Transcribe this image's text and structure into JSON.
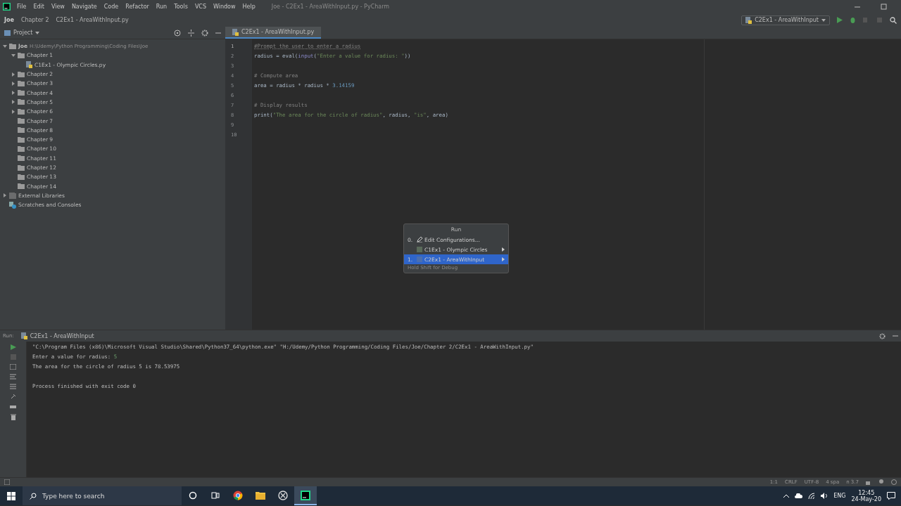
{
  "window": {
    "title": "Joe - C2Ex1 - AreaWithInput.py - PyCharm"
  },
  "menu": [
    "File",
    "Edit",
    "View",
    "Navigate",
    "Code",
    "Refactor",
    "Run",
    "Tools",
    "VCS",
    "Window",
    "Help"
  ],
  "breadcrumbs": [
    "Joe",
    "Chapter 2",
    "C2Ex1 - AreaWithInput.py"
  ],
  "run_config": "C2Ex1 - AreaWithInput",
  "project_panel": {
    "title": "Project"
  },
  "editor_tabs": [
    {
      "label": "C2Ex1 - AreaWithInput.py",
      "selected": true
    }
  ],
  "tree": [
    {
      "label": "Joe",
      "path": "H:\\Udemy\\Python Programming\\Coding Files\\Joe",
      "kind": "folder",
      "expanded": true,
      "children": [
        {
          "label": "Chapter 1",
          "kind": "folder",
          "expanded": true,
          "children": [
            {
              "label": "C1Ex1 - Olympic Circles.py",
              "kind": "file"
            }
          ]
        },
        {
          "label": "Chapter 2",
          "kind": "folder",
          "expanded": false
        },
        {
          "label": "Chapter 3",
          "kind": "folder",
          "expanded": false
        },
        {
          "label": "Chapter 4",
          "kind": "folder",
          "expanded": false
        },
        {
          "label": "Chapter 5",
          "kind": "folder",
          "expanded": false
        },
        {
          "label": "Chapter 6",
          "kind": "folder",
          "expanded": false
        },
        {
          "label": "Chapter 7",
          "kind": "folder"
        },
        {
          "label": "Chapter 8",
          "kind": "folder"
        },
        {
          "label": "Chapter 9",
          "kind": "folder"
        },
        {
          "label": "Chapter 10",
          "kind": "folder"
        },
        {
          "label": "Chapter 11",
          "kind": "folder"
        },
        {
          "label": "Chapter 12",
          "kind": "folder"
        },
        {
          "label": "Chapter 13",
          "kind": "folder"
        },
        {
          "label": "Chapter 14",
          "kind": "folder"
        }
      ]
    },
    {
      "label": "External Libraries",
      "kind": "library",
      "expanded": false
    },
    {
      "label": "Scratches and Consoles",
      "kind": "scratch"
    }
  ],
  "code": [
    {
      "number": "1",
      "tokens": [
        {
          "kind": "todo",
          "text": "#Prompt the user to enter a radius"
        }
      ]
    },
    {
      "number": "2",
      "tokens": [
        {
          "kind": "plain",
          "text": "radius = eval("
        },
        {
          "kind": "builtin",
          "text": "input"
        },
        {
          "kind": "plain",
          "text": "("
        },
        {
          "kind": "string",
          "text": "\"Enter a value for radius: \""
        },
        {
          "kind": "plain",
          "text": "))"
        }
      ]
    },
    {
      "number": "3"
    },
    {
      "number": "4",
      "tokens": [
        {
          "kind": "comment",
          "text": "# Compute area"
        }
      ]
    },
    {
      "number": "5",
      "tokens": [
        {
          "kind": "plain",
          "text": "area = radius * radius * "
        },
        {
          "kind": "number",
          "text": "3.14159"
        }
      ]
    },
    {
      "number": "6"
    },
    {
      "number": "7",
      "tokens": [
        {
          "kind": "comment",
          "text": "# Display results"
        }
      ]
    },
    {
      "number": "8",
      "tokens": [
        {
          "kind": "plain",
          "text": "print("
        },
        {
          "kind": "string",
          "text": "\"The area for the circle of radius\""
        },
        {
          "kind": "plain",
          "text": ", radius, "
        },
        {
          "kind": "string",
          "text": "\"is\""
        },
        {
          "kind": "plain",
          "text": ", area)"
        }
      ]
    },
    {
      "number": "9"
    },
    {
      "number": "10"
    }
  ],
  "run_popup": {
    "title": "Run",
    "hint": "Hold Shift for Debug",
    "items": [
      {
        "mnemonic": "0.",
        "label": "Edit Configurations...",
        "kind": "edit",
        "selected": false,
        "submenu": false
      },
      {
        "label": "C1Ex1 - Olympic Circles",
        "kind": "config",
        "selected": false,
        "submenu": true
      },
      {
        "mnemonic": "1.",
        "label": "C2Ex1 - AreaWithInput",
        "kind": "config",
        "selected": true,
        "submenu": true
      }
    ]
  },
  "run_panel": {
    "label": "Run:",
    "tab": "C2Ex1 - AreaWithInput",
    "lines": [
      {
        "kind": "command",
        "text": "\"C:\\Program Files (x86)\\Microsoft Visual Studio\\Shared\\Python37_64\\python.exe\" \"H:/Udemy/Python Programming/Coding Files/Joe/Chapter 2/C2Ex1 - AreaWithInput.py\""
      },
      {
        "kind": "prompt",
        "text": "Enter a value for radius: ",
        "input": "5"
      },
      {
        "kind": "output",
        "text": "The area for the circle of radius 5 is 78.53975"
      },
      {
        "kind": "blank"
      },
      {
        "kind": "output",
        "text": "Process finished with exit code 0"
      }
    ]
  },
  "status_bar": [
    "1:1",
    "CRLF",
    "UTF-8",
    "4 spa",
    "n 3.7"
  ],
  "taskbar": {
    "search_placeholder": "Type here to search",
    "apps": [
      {
        "kind": "cortana",
        "selected": false
      },
      {
        "kind": "taskview",
        "selected": false
      },
      {
        "kind": "chrome",
        "selected": false
      },
      {
        "kind": "explorer",
        "selected": false
      },
      {
        "kind": "vs",
        "selected": false
      },
      {
        "kind": "pycharm",
        "selected": true
      }
    ],
    "language": "ENG",
    "time": "12:45",
    "date": "24-May-20"
  }
}
